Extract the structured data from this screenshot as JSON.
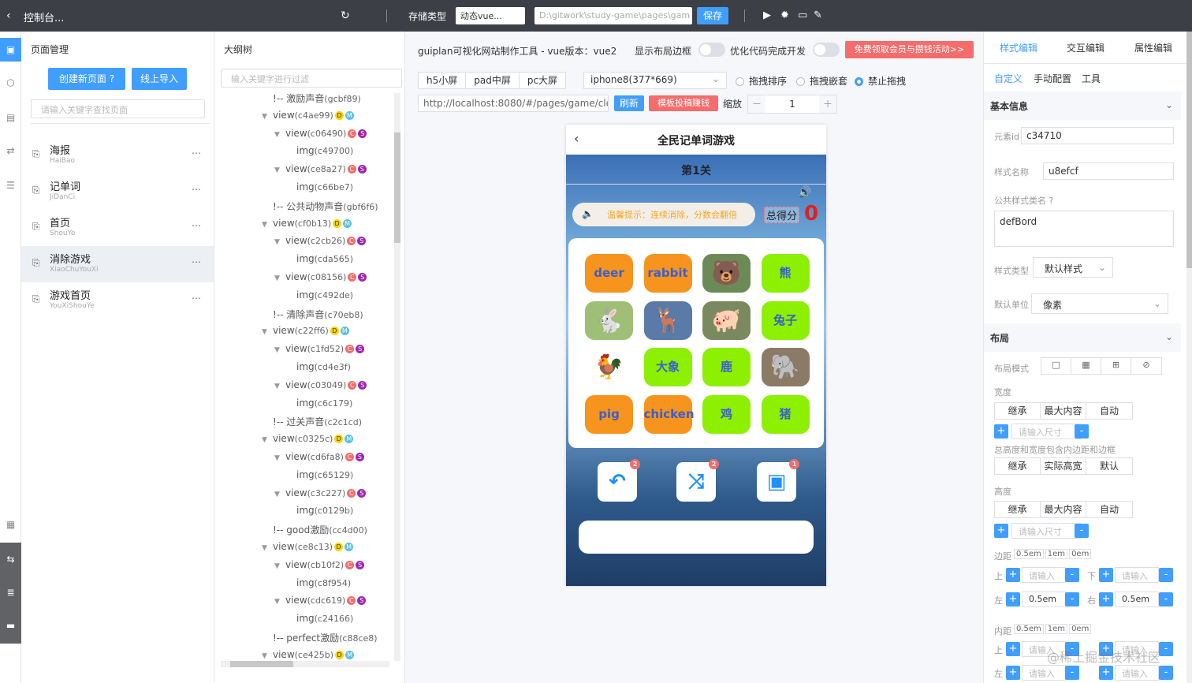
{
  "topbar": {
    "back_glyph": "‹",
    "title": "控制台...",
    "refresh_glyph": "↻",
    "storage_label": "存储类型",
    "storage_value": "动态vue...",
    "path_value": "D:\\gitwork\\study-game\\pages\\gam",
    "save_label": "保存",
    "icon_play": "▶",
    "icon_bug": "✹",
    "icon_folder": "▭",
    "icon_edit": "✎"
  },
  "rail": {
    "icon_pages": "▣",
    "icon_comp": "⬡",
    "icon_grid": "▤",
    "icon_link": "⇄",
    "icon_db": "☰",
    "icon_book": "▦",
    "icon_swap": "⇆",
    "icon_list": "≣",
    "icon_panel": "▬"
  },
  "pages": {
    "header": "页面管理",
    "create_label": "创建新页面 ?",
    "import_label": "线上导入",
    "search_placeholder": "请输入关键字查找页面",
    "items": [
      {
        "name": "海报",
        "pinyin": "HaiBao",
        "more": "…"
      },
      {
        "name": "记单词",
        "pinyin": "JiDanCi",
        "more": "…"
      },
      {
        "name": "首页",
        "pinyin": "ShouYe",
        "more": "…"
      },
      {
        "name": "消除游戏",
        "pinyin": "XiaoChuYouXi",
        "more": "…"
      },
      {
        "name": "游戏首页",
        "pinyin": "YouXiShouYe",
        "more": "…"
      }
    ]
  },
  "tree": {
    "header": "大纲树",
    "filter_placeholder": "输入关键字进行过滤",
    "rows": [
      {
        "text": "!-- 激励声音",
        "id": "(gcbf89)"
      },
      {
        "text": "view",
        "id": "(c4ae99)"
      },
      {
        "text": "view",
        "id": "(c06490)"
      },
      {
        "text": "img",
        "id": "(c49700)"
      },
      {
        "text": "view",
        "id": "(ce8a27)"
      },
      {
        "text": "img",
        "id": "(c66be7)"
      },
      {
        "text": "!-- 公共动物声音",
        "id": "(gbf6f6)"
      },
      {
        "text": "view",
        "id": "(cf0b13)"
      },
      {
        "text": "view",
        "id": "(c2cb26)"
      },
      {
        "text": "img",
        "id": "(cda565)"
      },
      {
        "text": "view",
        "id": "(c08156)"
      },
      {
        "text": "img",
        "id": "(c492de)"
      },
      {
        "text": "!-- 清除声音",
        "id": "(c70eb8)"
      },
      {
        "text": "view",
        "id": "(c22ff6)"
      },
      {
        "text": "view",
        "id": "(c1fd52)"
      },
      {
        "text": "img",
        "id": "(cd4e3f)"
      },
      {
        "text": "view",
        "id": "(c03049)"
      },
      {
        "text": "img",
        "id": "(c6c179)"
      },
      {
        "text": "!-- 过关声音",
        "id": "(c2c1cd)"
      },
      {
        "text": "view",
        "id": "(c0325c)"
      },
      {
        "text": "view",
        "id": "(cd6fa8)"
      },
      {
        "text": "img",
        "id": "(c65129)"
      },
      {
        "text": "view",
        "id": "(c3c227)"
      },
      {
        "text": "img",
        "id": "(c0129b)"
      },
      {
        "text": "!-- good激励",
        "id": "(cc4d00)"
      },
      {
        "text": "view",
        "id": "(ce8c13)"
      },
      {
        "text": "view",
        "id": "(cb10f2)"
      },
      {
        "text": "img",
        "id": "(c8f954)"
      },
      {
        "text": "view",
        "id": "(cdc619)"
      },
      {
        "text": "img",
        "id": "(c24166)"
      },
      {
        "text": "!-- perfect激励",
        "id": "(c88ce8)"
      },
      {
        "text": "view",
        "id": "(ce425b)"
      }
    ]
  },
  "center": {
    "info": "guiplan可视化网站制作工具 - vue版本：vue2",
    "show_border_label": "显示布局边框",
    "optimize_label": "优化代码完成开发",
    "promo_label": "免费领取会员与攒钱活动>>",
    "screens": [
      "h5小屏",
      "pad中屏",
      "pc大屏"
    ],
    "device": "iphone8(377*669)",
    "device_caret": "⌄",
    "drag_sort": "拖拽排序",
    "drag_nest": "拖拽嵌套",
    "drag_off": "禁止拖拽",
    "url": "http://localhost:8080/#/pages/game/clear-g",
    "refresh_btn": "刷新",
    "template_btn": "模板投稿赚钱",
    "zoom_label": "缩放",
    "zoom_minus": "－",
    "zoom_plus": "＋",
    "zoom_value": "1"
  },
  "game": {
    "back_glyph": "‹",
    "title": "全民记单词游戏",
    "level": "第1关",
    "speaker": "🔊",
    "tip_icon": "🔈",
    "tip": "温馨提示：连续消除，分数会翻倍",
    "score_label": "总得分",
    "score_value": "0",
    "cards": [
      {
        "kind": "text",
        "color": "orange",
        "label": "deer"
      },
      {
        "kind": "text",
        "color": "orange",
        "label": "rabbit"
      },
      {
        "kind": "img",
        "animal": "bear"
      },
      {
        "kind": "text",
        "color": "green",
        "label": "熊"
      },
      {
        "kind": "img",
        "animal": "rabbit"
      },
      {
        "kind": "img",
        "animal": "deer"
      },
      {
        "kind": "img",
        "animal": "pig"
      },
      {
        "kind": "text",
        "color": "green",
        "label": "兔子"
      },
      {
        "kind": "img",
        "animal": "chicken"
      },
      {
        "kind": "text",
        "color": "green",
        "label": "大象"
      },
      {
        "kind": "text",
        "color": "green",
        "label": "鹿"
      },
      {
        "kind": "img",
        "animal": "elephant"
      },
      {
        "kind": "text",
        "color": "orange",
        "label": "pig"
      },
      {
        "kind": "text",
        "color": "orange",
        "label": "chicken"
      },
      {
        "kind": "text",
        "color": "green",
        "label": "鸡"
      },
      {
        "kind": "text",
        "color": "green",
        "label": "猪"
      }
    ],
    "tools": [
      {
        "icon": "↶",
        "count": "2"
      },
      {
        "icon": "⤨",
        "count": "2"
      },
      {
        "icon": "▣",
        "count": "1"
      }
    ]
  },
  "right": {
    "tabs": [
      "样式编辑",
      "交互编辑",
      "属性编辑"
    ],
    "subtabs": [
      "自定义",
      "手动配置",
      "工具"
    ],
    "basic_title": "基本信息",
    "chevron": "⌄",
    "elem_id_label": "元素id",
    "elem_id": "c34710",
    "style_name_label": "样式名称",
    "style_name": "u8efcf",
    "public_class_label": "公共样式类名 ?",
    "public_class": "defBord",
    "style_type_label": "样式类型",
    "style_type": "默认样式",
    "unit_label": "默认单位",
    "unit": "像素",
    "layout_title": "布局",
    "layout_mode_label": "布局模式",
    "layout_modes": [
      "□",
      "▦",
      "⊞",
      "⊘"
    ],
    "width_label": "宽度",
    "size_opts": [
      "继承",
      "最大内容",
      "自动"
    ],
    "size_placeholder": "请输入尺寸",
    "box_sizing_label": "总高度和宽度包含内边距和边框",
    "box_opts": [
      "继承",
      "实际高宽",
      "默认"
    ],
    "height_label": "高度",
    "margin_label": "边距",
    "margin_units": [
      "0.5em",
      "1em",
      "0em"
    ],
    "pad_label": "内距",
    "pad_units": [
      "0.5em",
      "1em",
      "0em"
    ],
    "top": "上",
    "bottom": "下",
    "left": "左",
    "right": "右",
    "input_placeholder": "请输入",
    "margin_left_val": "0.5em",
    "margin_right_val": "0.5em",
    "plus": "+",
    "minus": "-"
  },
  "watermark": "@稀土掘金技术社区"
}
